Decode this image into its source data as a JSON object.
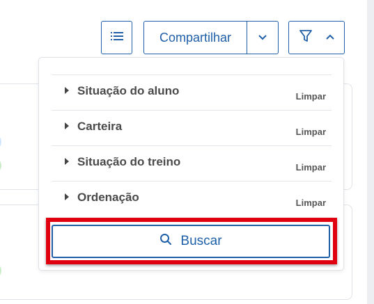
{
  "toolbar": {
    "list_icon": "list-icon",
    "share_label": "Compartilhar",
    "share_caret_icon": "chevron-down-icon",
    "filter_icon": "filter-icon",
    "filter_caret_icon": "chevron-up-icon"
  },
  "filters": {
    "items": [
      {
        "label": "Situação do aluno",
        "clear_label": "Limpar"
      },
      {
        "label": "Carteira",
        "clear_label": "Limpar"
      },
      {
        "label": "Situação do treino",
        "clear_label": "Limpar"
      },
      {
        "label": "Ordenação",
        "clear_label": "Limpar"
      }
    ],
    "search_label": "Buscar",
    "search_icon": "search-icon"
  },
  "colors": {
    "accent": "#1f5fa8",
    "highlight": "#e0000f"
  }
}
